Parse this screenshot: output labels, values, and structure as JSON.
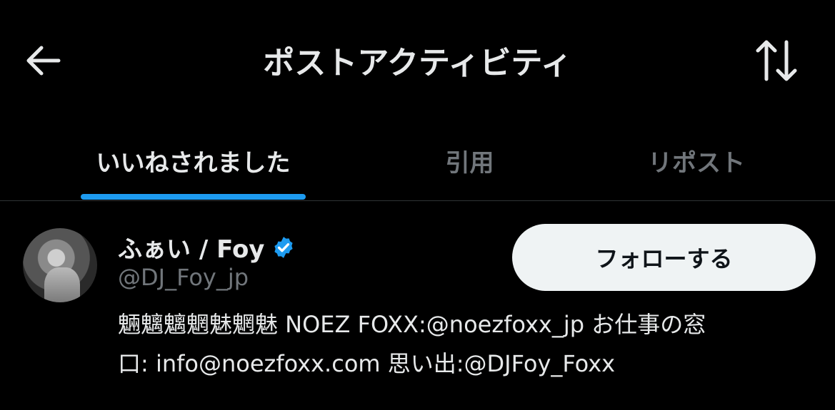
{
  "header": {
    "title": "ポストアクティビティ",
    "back_icon": "arrow-left-icon",
    "sort_icon": "sort-arrows-icon"
  },
  "tabs": [
    {
      "label": "いいねされました",
      "active": true
    },
    {
      "label": "引用",
      "active": false
    },
    {
      "label": "リポスト",
      "active": false
    }
  ],
  "user": {
    "display_name": "ふぁい / Foy",
    "handle": "@DJ_Foy_jp",
    "verified": true,
    "follow_label": "フォローする",
    "bio_line1": "魎魑魑魍魅魍魅 NOEZ FOXX:@noezfoxx_jp お仕事の窓",
    "bio_line2": "口: info@noezfoxx.com 思い出:@DJFoy_Foxx"
  },
  "colors": {
    "background": "#000000",
    "accent": "#1d9bf0",
    "text_primary": "#e7e9ea",
    "text_secondary": "#71767b",
    "button_bg": "#eff3f4"
  }
}
